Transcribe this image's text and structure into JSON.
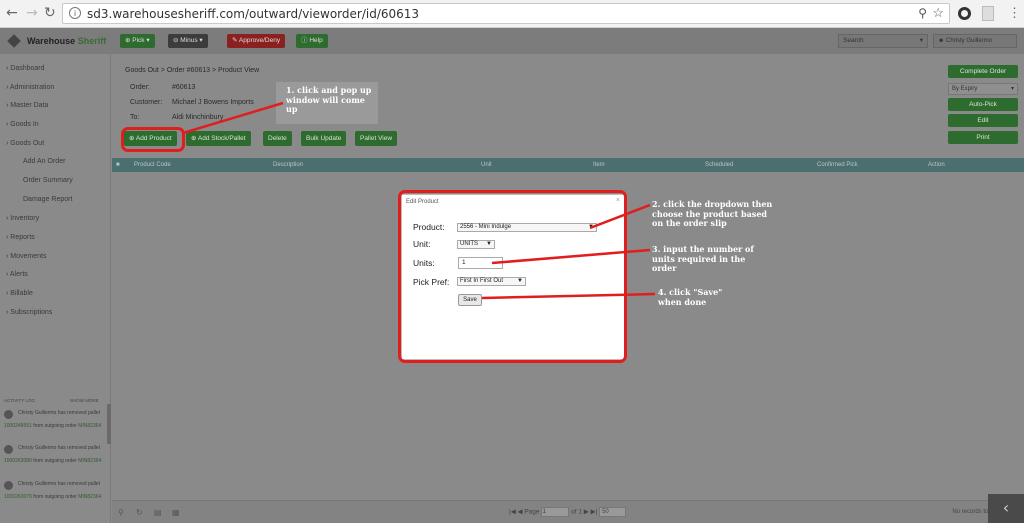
{
  "browser": {
    "url": "sd3.warehousesheriff.com/outward/vieworder/id/60613"
  },
  "header": {
    "logo_main": "Warehouse",
    "logo_accent": "Sheriff",
    "buttons": {
      "pick": "Pick",
      "minus": "Minus",
      "approve": "Approve/Deny",
      "help": "Help"
    },
    "search_placeholder": "Search",
    "user": "Christy Guillermo"
  },
  "sidebar": {
    "items": [
      "Dashboard",
      "Administration",
      "Master Data",
      "Goods In",
      "Goods Out",
      "Add An Order",
      "Order Summary",
      "Damage Report",
      "Inventory",
      "Reports",
      "Movements",
      "Alerts",
      "Billable",
      "Subscriptions"
    ],
    "activity": {
      "title": "ACTIVITY LOG",
      "show_more": "SHOW MORE",
      "entries": [
        {
          "who": "Christy Guillermo has removed pallet",
          "code": "1000248551",
          "mid": "from outgoing order",
          "order": "MIN82364"
        },
        {
          "who": "Christy Guillermo has removed pallet",
          "code": "1000263080",
          "mid": "from outgoing order",
          "order": "MIN82364"
        },
        {
          "who": "Christy Guillermo has removed pallet",
          "code": "1000263079",
          "mid": "from outgoing order",
          "order": "MIN82364"
        }
      ]
    }
  },
  "main": {
    "breadcrumb": "Goods Out > Order #60613 > Product View",
    "order_label": "Order:",
    "order_value": "#60613",
    "customer_label": "Customer:",
    "customer_value": "Michael J Bowens Imports",
    "to_label": "To:",
    "to_value": "Aldi Minchinbury",
    "toolbar": {
      "add_product": "Add Product",
      "add_stock": "Add Stock/Pallet",
      "delete": "Delete",
      "bulk_update": "Bulk Update",
      "pallet_view": "Pallet View"
    },
    "right": {
      "complete": "Complete Order",
      "expiry_select": "By Expiry",
      "autopick": "Auto-Pick",
      "edit": "Edit",
      "print": "Print"
    },
    "table_headers": [
      "Product Code",
      "Description",
      "Unit",
      "Item",
      "Scheduled",
      "Confirmed Pick",
      "Action"
    ],
    "footer": {
      "page_label": "Page",
      "page_of": "of 1",
      "page_value": "1",
      "per_page": "50",
      "no_records": "No records to view"
    }
  },
  "modal": {
    "title": "Edit Product",
    "product_label": "Product:",
    "product_value": "2556 - Mini Indulge",
    "unit_label": "Unit:",
    "unit_value": "UNITS",
    "units_label": "Units:",
    "units_value": "1",
    "pick_label": "Pick Pref:",
    "pick_value": "First In First Out",
    "save": "Save"
  },
  "annotations": {
    "step1": "1. click and pop up window will come up",
    "step2": "2. click the dropdown then choose the product based on the order slip",
    "step3": "3. input the number of units required in the order",
    "step4": "4. click \"Save\" when done",
    "highlight_color": "#e01e1e"
  }
}
